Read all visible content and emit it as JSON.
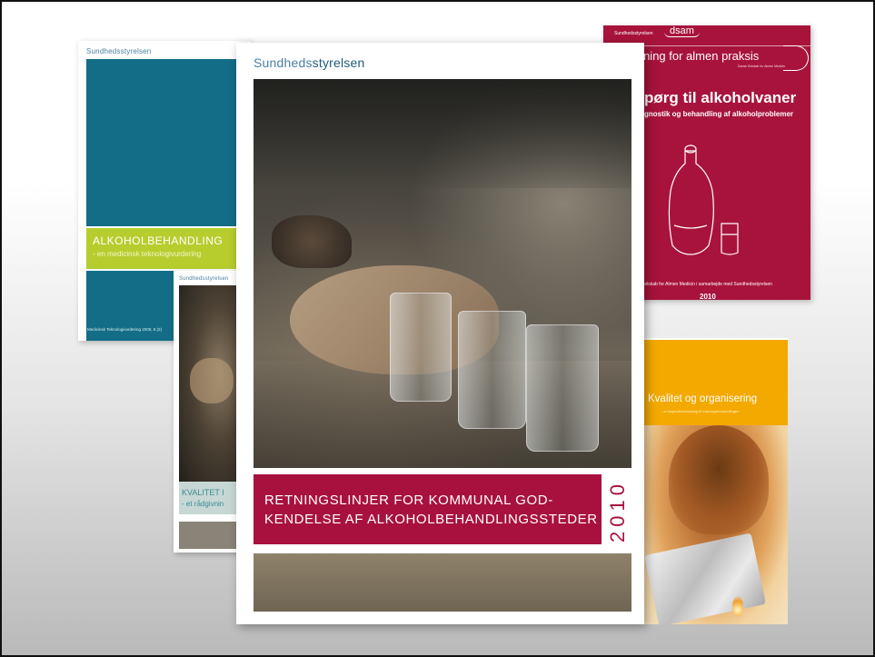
{
  "covers": {
    "alkoholbehandling": {
      "logo": "Sundhedsstyrelsen",
      "title": "ALKOHOLBEHANDLING",
      "subtitle": "- en medicinsk teknologivurdering",
      "footer": "Medicinsk Teknologivurdering 2006; 8 (2)",
      "colors": {
        "blue": "#136d86",
        "green": "#b7cd2e"
      }
    },
    "kvalitet_i": {
      "logo": "Sundhedsstyrelsen",
      "title": "KVALITET I",
      "subtitle": "- et rådgivnin"
    },
    "retningslinjer": {
      "logo_prefix": "Sundheds",
      "logo_suffix": "styrelsen",
      "title_line1": "RETNINGSLINJER FOR KOMMUNAL GOD-",
      "title_line2": "KENDELSE AF ALKOHOLBEHANDLINGSSTEDER",
      "year": "2010",
      "colors": {
        "band": "#a8113e"
      }
    },
    "spoerg": {
      "logo_left": "Sundhedsstyrelsen",
      "logo_right": "dsam",
      "subtitle_line": "k vejledning for almen praksis",
      "tiny": "Dansk Selskab for Almen Medicin",
      "title": "pørg til alkoholvaner",
      "sub": "gnostik og behandling af alkoholproblemer",
      "credit": "Selskab for Almen Medicin i samarbejde med Sundhedsstyrelsen",
      "year": "2010",
      "colors": {
        "background": "#a8133c"
      }
    },
    "kvalitet_og_organisering": {
      "title": "Kvalitet og organisering",
      "subtitle": "- et inspirationskatalog til misbrugsbehandlingen",
      "colors": {
        "orange": "#f3a900"
      }
    }
  },
  "icons": [
    "crown-icon",
    "decanter-illustration"
  ]
}
